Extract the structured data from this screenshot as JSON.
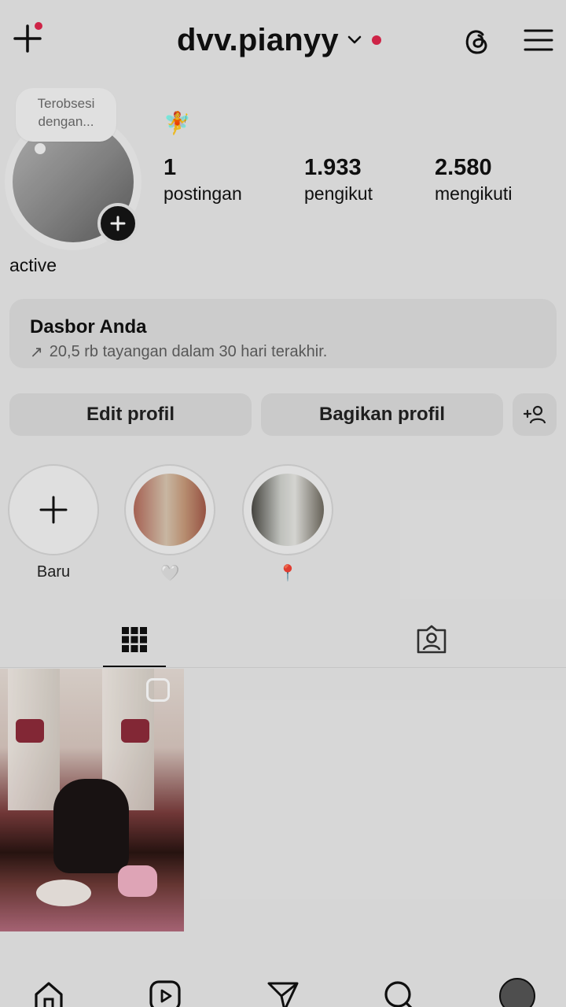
{
  "header": {
    "username": "dvv.pianyy",
    "notification_color": "#e0284e"
  },
  "profile": {
    "note_text": "Terobsesi dengan...",
    "emoji": "🧚",
    "bio": "active",
    "stats": [
      {
        "value": "1",
        "label": "postingan"
      },
      {
        "value": "1.933",
        "label": "pengikut"
      },
      {
        "value": "2.580",
        "label": "mengikuti"
      }
    ]
  },
  "dashboard": {
    "title": "Dasbor Anda",
    "arrow": "↗",
    "subtitle": "20,5 rb tayangan dalam 30 hari terakhir."
  },
  "buttons": {
    "edit": "Edit profil",
    "share": "Bagikan profil"
  },
  "highlights": [
    {
      "label": "Baru",
      "icon": "plus-icon"
    },
    {
      "label": "🤍",
      "icon": "image"
    },
    {
      "label": "📍",
      "icon": "image"
    }
  ],
  "icons": {
    "top": [
      "plus-icon",
      "chevron-down-icon",
      "threads-icon",
      "menu-icon"
    ],
    "tabs": [
      "grid-icon",
      "tagged-icon"
    ],
    "bottom": [
      "home-icon",
      "reels-icon",
      "send-icon",
      "search-icon",
      "profile-avatar"
    ]
  }
}
